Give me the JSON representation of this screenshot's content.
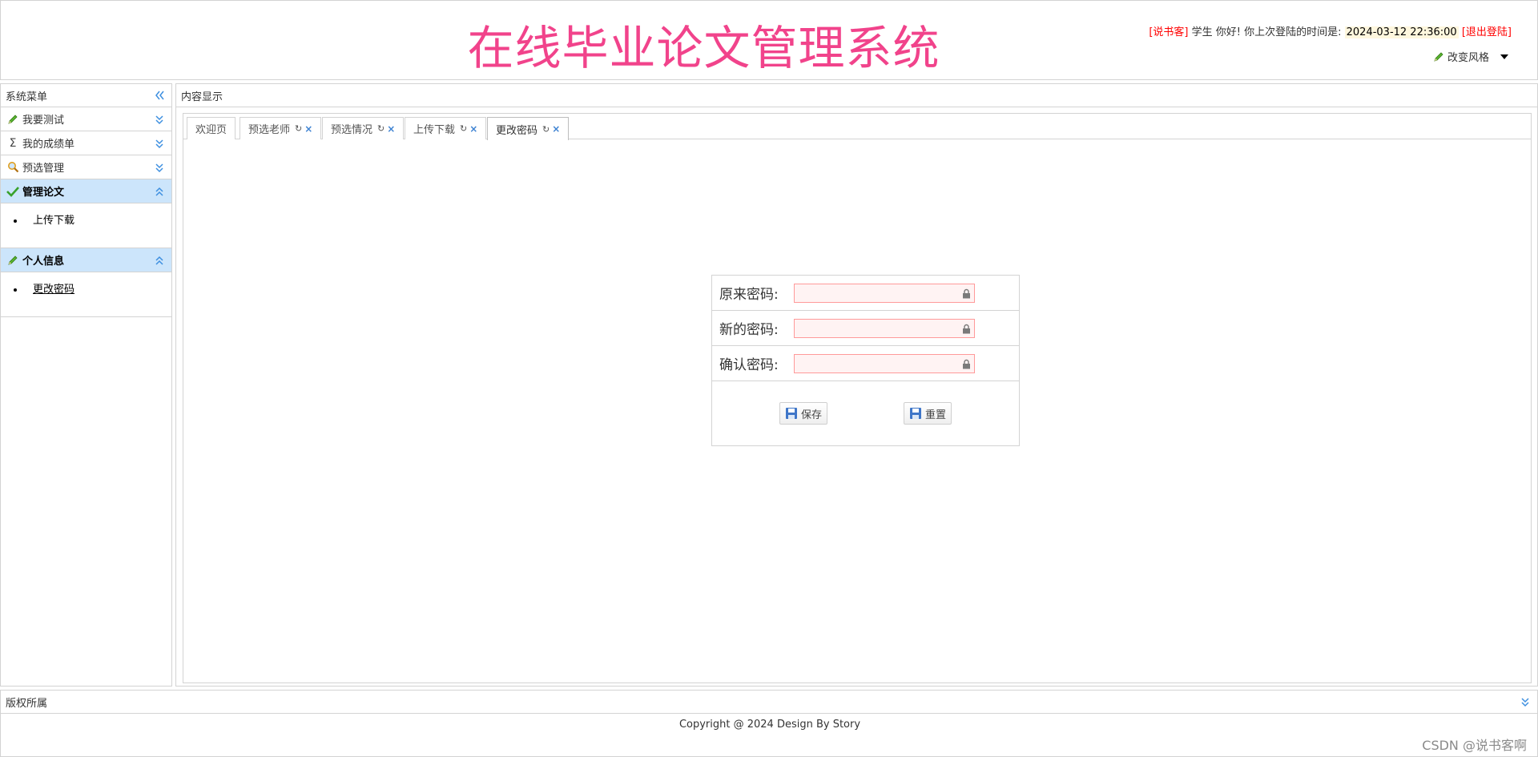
{
  "header": {
    "title": "在线毕业论文管理系统",
    "user_name": "[说书客]",
    "greeting": "学生 你好! 你上次登陆的时间是:",
    "last_login": "2024-03-12 22:36:00",
    "logout": "[退出登陆]",
    "style_switch": "改变风格"
  },
  "sidebar": {
    "title": "系统菜单",
    "menus": [
      {
        "label": "我要测试",
        "icon": "pencil-icon"
      },
      {
        "label": "我的成绩单",
        "icon": "sigma-icon"
      },
      {
        "label": "预选管理",
        "icon": "magnifier-icon"
      },
      {
        "label": "管理论文",
        "icon": "check-icon",
        "items": [
          "上传下载"
        ]
      },
      {
        "label": "个人信息",
        "icon": "pencil-icon",
        "items": [
          "更改密码"
        ]
      }
    ]
  },
  "main": {
    "title": "内容显示",
    "tabs": [
      {
        "label": "欢迎页"
      },
      {
        "label": "预选老师"
      },
      {
        "label": "预选情况"
      },
      {
        "label": "上传下载"
      },
      {
        "label": "更改密码"
      }
    ],
    "form": {
      "old_password_label": "原来密码:",
      "new_password_label": "新的密码:",
      "confirm_password_label": "确认密码:",
      "save_label": "保存",
      "reset_label": "重置"
    }
  },
  "footer": {
    "title": "版权所属",
    "copyright": "Copyright @ 2024 Design By Story"
  },
  "watermark": "CSDN @说书客啊",
  "colors": {
    "title": "#f1438b",
    "active_menu": "#cce5fb",
    "field_bg": "#fff3f3",
    "field_border": "#ff9a9a",
    "accent_blue": "#3d82d2"
  }
}
